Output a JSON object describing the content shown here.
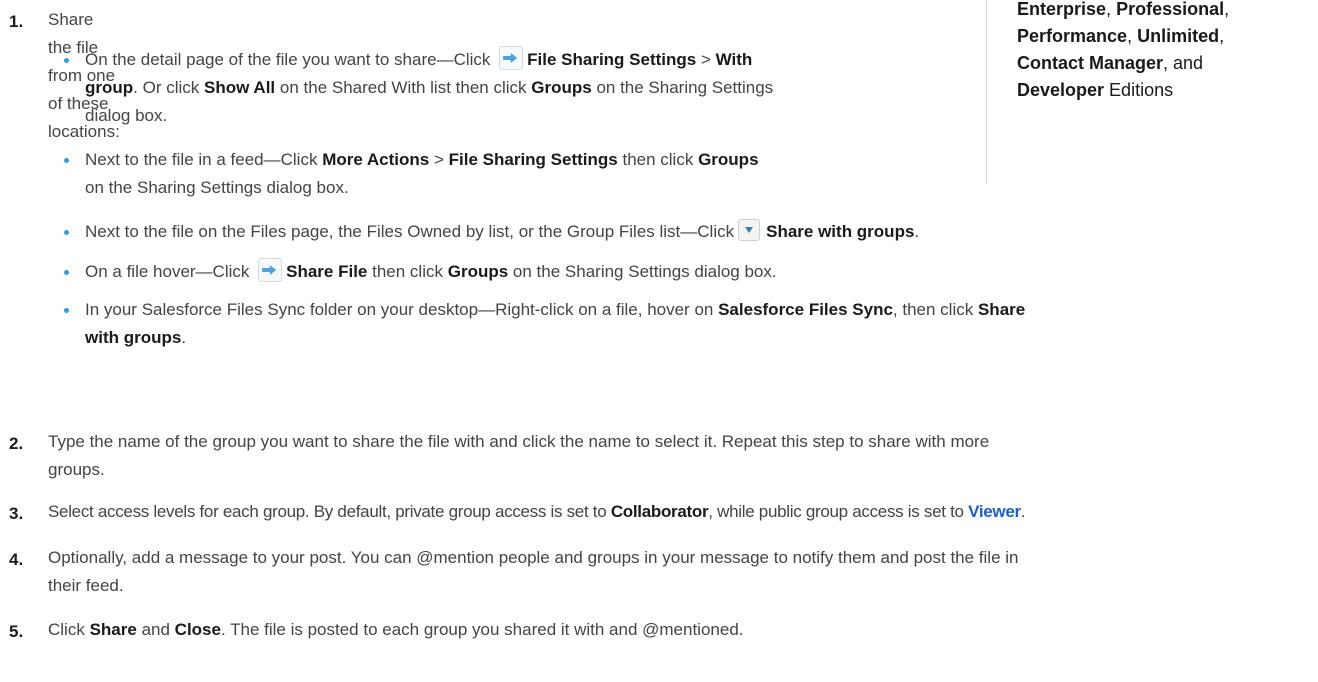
{
  "sidebar": {
    "lines": [
      [
        {
          "t": "Enterprise",
          "b": true
        },
        {
          "t": ", ",
          "b": false
        },
        {
          "t": "Professional",
          "b": true
        },
        {
          "t": ",",
          "b": false
        }
      ],
      [
        {
          "t": "Performance",
          "b": true
        },
        {
          "t": ", ",
          "b": false
        },
        {
          "t": "Unlimited",
          "b": true
        },
        {
          "t": ",",
          "b": false
        }
      ],
      [
        {
          "t": "Contact Manager",
          "b": true
        },
        {
          "t": ", and",
          "b": false
        }
      ],
      [
        {
          "t": "Developer",
          "b": true
        },
        {
          "t": " Editions",
          "b": false
        }
      ]
    ]
  },
  "steps": {
    "s1": {
      "num": "1.",
      "text": "Share the file from one of these locations:"
    },
    "b1": {
      "a": "On the detail page of the file you want to share—Click",
      "b": "File Sharing Settings",
      "c": ">",
      "d": "With",
      "e": "group",
      "f": ". Or click",
      "g": "Show All",
      "h": "on the Shared With list then click",
      "i": "Groups",
      "j": "on the Sharing Settings",
      "k": "dialog box."
    },
    "b2": {
      "a": "Next to the file in a feed—Click",
      "b": "More Actions",
      "c": ">",
      "d": "File Sharing Settings",
      "e": "then click",
      "f": "Groups",
      "g": "on the Sharing Settings dialog box."
    },
    "b3": {
      "a": "Next to the file on the Files page, the Files Owned by list, or the Group Files list—Click",
      "b": "Share with groups",
      "c": "."
    },
    "b4": {
      "a": "On a file hover—Click",
      "b": "Share File",
      "c": "then click",
      "d": "Groups",
      "e": "on the Sharing Settings dialog box."
    },
    "b5": {
      "a": "In your Salesforce Files Sync folder on your desktop—Right-click on a file, hover on",
      "b": "Salesforce Files Sync",
      "c": ", then click",
      "d": "Share",
      "e": "with groups",
      "f": "."
    },
    "s2": {
      "num": "2.",
      "line1": "Type the name of the group you want to share the file with and click the name to select it. Repeat this step to share with more",
      "line2": "groups."
    },
    "s3": {
      "num": "3.",
      "a": "Select access levels for each group. By default, private group access is set to",
      "b": "Collaborator",
      "c": ", while public group access is set to",
      "d": "Viewer",
      "e": "."
    },
    "s4": {
      "num": "4.",
      "line1": "Optionally, add a message to your post. You can @mention people and groups in your message to notify them and post the file in",
      "line2": "their feed."
    },
    "s5": {
      "num": "5.",
      "a": "Click",
      "b": "Share",
      "c": "and",
      "d": "Close",
      "e": ". The file is posted to each group you shared it with and @mentioned."
    }
  },
  "icons": {
    "share": "share-file-icon",
    "dropdown": "dropdown-arrow-icon"
  },
  "colors": {
    "accent": "#2a9de8",
    "link": "#1a5fd1",
    "text": "#444444"
  }
}
